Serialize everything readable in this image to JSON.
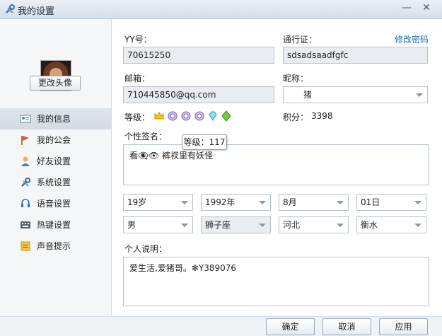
{
  "window": {
    "title": "我的设置",
    "icon": "wrench-screwdriver-icon"
  },
  "profile": {
    "change_avatar_label": "更改头像"
  },
  "nav": [
    {
      "label": "我的信息",
      "icon": "id-card-icon",
      "active": true
    },
    {
      "label": "我的公会",
      "icon": "flag-icon"
    },
    {
      "label": "好友设置",
      "icon": "person-icon"
    },
    {
      "label": "系统设置",
      "icon": "tools-icon"
    },
    {
      "label": "语音设置",
      "icon": "headset-icon"
    },
    {
      "label": "热键设置",
      "icon": "keyboard-icon"
    },
    {
      "label": "声音提示",
      "icon": "note-icon"
    }
  ],
  "form": {
    "yy_label": "YY号：",
    "yy_value": "70615250",
    "passport_label": "通行证：",
    "passport_value": "sdsadsaadfgfc",
    "change_password_link": "修改密码",
    "email_label": "邮箱：",
    "email_value": "710445850@qq.com",
    "nickname_label": "昵称：",
    "nickname_value": "猪",
    "level_label": "等级：",
    "level_icons": [
      "crown-icon",
      "medal-icon",
      "medal-icon",
      "medal-icon",
      "diamond-icon",
      "star-icon"
    ],
    "points_label": "积分：",
    "points_value": "3398",
    "signature_label": "个性签名：",
    "signature_value": "看👁‍🗨👁 裤衩里有妖怪",
    "tooltip": "等级：117",
    "age": "19岁",
    "year": "1992年",
    "month": "8月",
    "day": "01日",
    "gender": "男",
    "zodiac": "狮子座",
    "province": "河北",
    "city": "衡水",
    "desc_label": "个人说明：",
    "desc_value": "爱生活,爱猪哥。✻Y389076"
  },
  "footer": {
    "ok": "确定",
    "cancel": "取消",
    "apply": "应用"
  }
}
